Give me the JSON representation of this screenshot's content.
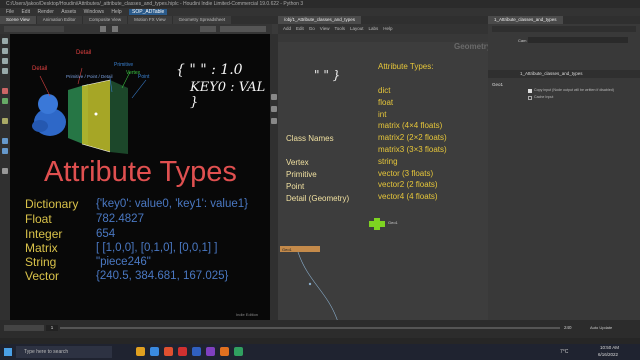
{
  "window": {
    "title": "C:/Users/jakoo/Desktop/Houdini/Attributes/_attribute_classes_and_types.hiplc - Houdini Indie Limited-Commercial 19.0.622 - Python 3"
  },
  "menu": [
    "File",
    "Edit",
    "Render",
    "Assets",
    "Windows",
    "Help",
    "SOP_ADTable"
  ],
  "tabs_left": [
    "Scene View",
    "Animation Editor",
    "Composite View",
    "Motion FX View",
    "Geometry Spreadsheet"
  ],
  "tabs_net": [
    "/obj/1_Attribute_classes_and_types"
  ],
  "tabs_side": [
    "1_Attribute_classes_and_types"
  ],
  "viewport": {
    "heading": "Attribute Types",
    "tag_detail1": "Detail",
    "tag_detail2": "Detail",
    "tag_primitive": "Primitive",
    "tag_vertex": "Vertex",
    "tag_point": "Point",
    "corner_label": "Indie Edition",
    "rows": [
      {
        "label": "Dictionary",
        "value": "{'key0': value0, 'key1': value1}"
      },
      {
        "label": "Float",
        "value": "782.4827"
      },
      {
        "label": "Integer",
        "value": "654"
      },
      {
        "label": "Matrix",
        "value": "[ [1,0,0], [0,1,0], [0,0,1] ]"
      },
      {
        "label": "String",
        "value": "\"piece246\""
      },
      {
        "label": "Vector",
        "value": "{240.5, 384.681, 167.025}"
      }
    ]
  },
  "handwriting": {
    "brace_line": "{ \" \" : 1.0",
    "key_line": "KEY0 : VAL }",
    "quote_left": "\" \" }"
  },
  "network": {
    "context_label": "Geometry",
    "class_names_title": "Class Names",
    "class_names": [
      "Vertex",
      "Primitive",
      "Point",
      "Detail (Geometry)"
    ],
    "types_title": "Attribute Types:",
    "types": [
      "dict",
      "float",
      "int",
      "matrix (4×4 floats)",
      "matrix2 (2×2 floats)",
      "matrix3 (3×3 floats)",
      "string",
      "vector (3 floats)",
      "vector2 (2 floats)",
      "vector4 (4 floats)"
    ],
    "node_name": "Geo1",
    "node_small": "Geo1"
  },
  "side": {
    "path": "1_Attribute_classes_and_types",
    "row_label": "Geo1",
    "check1": "Copy input (Node output will be written if disabled)",
    "check2": "Cache Input"
  },
  "timeline": {
    "frame": "1",
    "end": "240",
    "auto_update": "Auto Update"
  },
  "taskbar": {
    "search_placeholder": "Type here to search",
    "temp": "7°C",
    "time": "10:50 AM",
    "date": "6/16/2022"
  },
  "colors": {
    "accent_yellow": "#e6c63a",
    "value_blue": "#4a78c2",
    "heading_red": "#e05050",
    "node_green": "#7ed321"
  }
}
